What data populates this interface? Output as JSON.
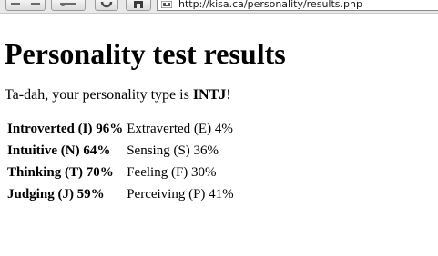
{
  "browser": {
    "url": "http://kisa.ca/personality/results.php",
    "icons": [
      "back-icon",
      "forward-icon",
      "key-icon",
      "reload-icon",
      "home-icon",
      "site-icon"
    ]
  },
  "page": {
    "title": "Personality test results",
    "intro_prefix": "Ta-dah, your personality type is ",
    "intro_type": "INTJ",
    "intro_suffix": "!",
    "results": [
      {
        "primary": "Introverted (I) 96%",
        "secondary": "Extraverted (E) 4%"
      },
      {
        "primary": "Intuitive (N) 64%",
        "secondary": "Sensing (S) 36%"
      },
      {
        "primary": "Thinking (T) 70%",
        "secondary": "Feeling (F) 30%"
      },
      {
        "primary": "Judging (J) 59%",
        "secondary": "Perceiving (P) 41%"
      }
    ]
  }
}
